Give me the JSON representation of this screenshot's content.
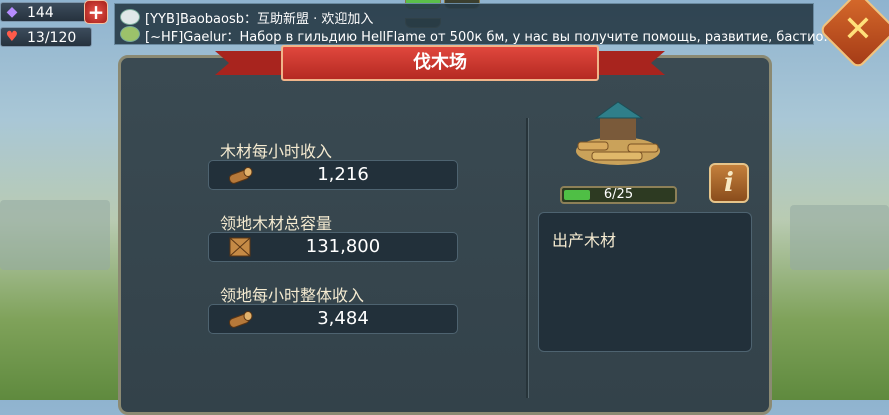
{
  "resources": {
    "gems": "144",
    "stamina": "13/120"
  },
  "chat": {
    "line1": "[YYB]Baobaosb：互助新盟 · 欢迎加入",
    "line2": "[~HF]Gaelur：Набор в гильдию HellFlame от 500к бм, у нас вы получите помощь, развитие, бастио..."
  },
  "panel": {
    "title": "伐木场",
    "stats": [
      {
        "label": "木材每小时收入",
        "value": "1,216",
        "icon": "log-icon"
      },
      {
        "label": "领地木材总容量",
        "value": "131,800",
        "icon": "crate-icon"
      },
      {
        "label": "领地每小时整体收入",
        "value": "3,484",
        "icon": "log-icon"
      }
    ],
    "level": {
      "text": "6/25",
      "fraction": 0.24
    },
    "info_label": "i",
    "production_title": "出产木材"
  },
  "colors": {
    "ribbon": "#c3342b",
    "level_fill": "#4fbf45",
    "panel": "#37464e"
  }
}
